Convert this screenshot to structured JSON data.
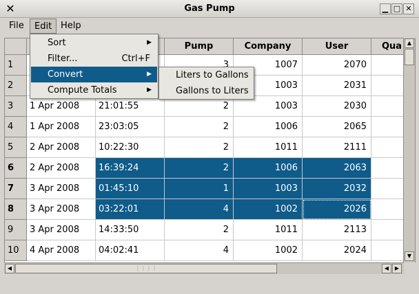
{
  "window": {
    "title": "Gas Pump",
    "app_icon": "✕",
    "minimize": "▁",
    "maximize": "□",
    "close": "✕"
  },
  "menubar": {
    "file": "File",
    "edit": "Edit",
    "help": "Help"
  },
  "edit_menu": {
    "sort": "Sort",
    "filter": "Filter...",
    "filter_shortcut": "Ctrl+F",
    "convert": "Convert",
    "compute_totals": "Compute Totals",
    "submenu_arrow": "▶"
  },
  "convert_submenu": {
    "liters_to_gallons": "Liters to Gallons",
    "gallons_to_liters": "Gallons to Liters"
  },
  "table": {
    "headers": [
      "",
      "",
      "Pump",
      "Company",
      "User",
      "Qua"
    ],
    "rows": [
      {
        "num": "1",
        "date": "",
        "time": "",
        "pump": "3",
        "company": "1007",
        "user": "2070"
      },
      {
        "num": "2",
        "date": "",
        "time": "",
        "pump": "2",
        "company": "1003",
        "user": "2031"
      },
      {
        "num": "3",
        "date": "1 Apr 2008",
        "time": "21:01:55",
        "pump": "2",
        "company": "1003",
        "user": "2030"
      },
      {
        "num": "4",
        "date": "1 Apr 2008",
        "time": "23:03:05",
        "pump": "2",
        "company": "1006",
        "user": "2065"
      },
      {
        "num": "5",
        "date": "2 Apr 2008",
        "time": "10:22:30",
        "pump": "2",
        "company": "1011",
        "user": "2111"
      },
      {
        "num": "6",
        "date": "2 Apr 2008",
        "time": "16:39:24",
        "pump": "2",
        "company": "1006",
        "user": "2063"
      },
      {
        "num": "7",
        "date": "3 Apr 2008",
        "time": "01:45:10",
        "pump": "1",
        "company": "1003",
        "user": "2032"
      },
      {
        "num": "8",
        "date": "3 Apr 2008",
        "time": "03:22:01",
        "pump": "4",
        "company": "1002",
        "user": "2026"
      },
      {
        "num": "9",
        "date": "3 Apr 2008",
        "time": "14:33:50",
        "pump": "2",
        "company": "1011",
        "user": "2113"
      },
      {
        "num": "10",
        "date": "4 Apr 2008",
        "time": "04:02:41",
        "pump": "4",
        "company": "1002",
        "user": "2024"
      }
    ]
  },
  "scroll": {
    "up": "▲",
    "down": "▼",
    "left": "◀",
    "right": "▶",
    "grip": "⋮⋮⋮⋮"
  },
  "colors": {
    "selection": "#0f5b8a",
    "chrome": "#d6d3ce"
  }
}
